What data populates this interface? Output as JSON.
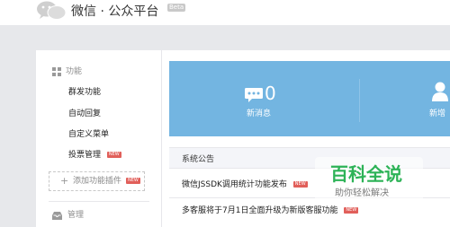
{
  "header": {
    "brand": "微信 · 公众平台",
    "beta": "Beta"
  },
  "sidebar": {
    "function_section": {
      "label": "功能",
      "icon": "grid-icon"
    },
    "items": [
      {
        "label": "群发功能"
      },
      {
        "label": "自动回复"
      },
      {
        "label": "自定义菜单"
      },
      {
        "label": "投票管理",
        "badge": "NEW"
      }
    ],
    "add_plugin": {
      "label": "添加功能插件",
      "badge": "NEW",
      "icon": "plus-icon"
    },
    "management_section": {
      "label": "管理",
      "icon": "inbox-icon"
    }
  },
  "stats": {
    "new_messages": {
      "count": "0",
      "label": "新消息",
      "icon": "message-icon"
    },
    "new_followers": {
      "label": "新增",
      "icon": "person-icon"
    }
  },
  "notices": {
    "title": "系统公告",
    "items": [
      {
        "text": "微信JSSDK调用统计功能发布",
        "badge": "NEW"
      },
      {
        "text": "多客服将于7月1日全面升级为新版客服功能",
        "badge": "NEW"
      }
    ]
  },
  "watermark": {
    "title": "百科全说",
    "subtitle": "助你轻松解决"
  },
  "colors": {
    "stats_bg": "#73b5e1",
    "badge": "#e15f5a",
    "watermark_green": "#2db357"
  }
}
